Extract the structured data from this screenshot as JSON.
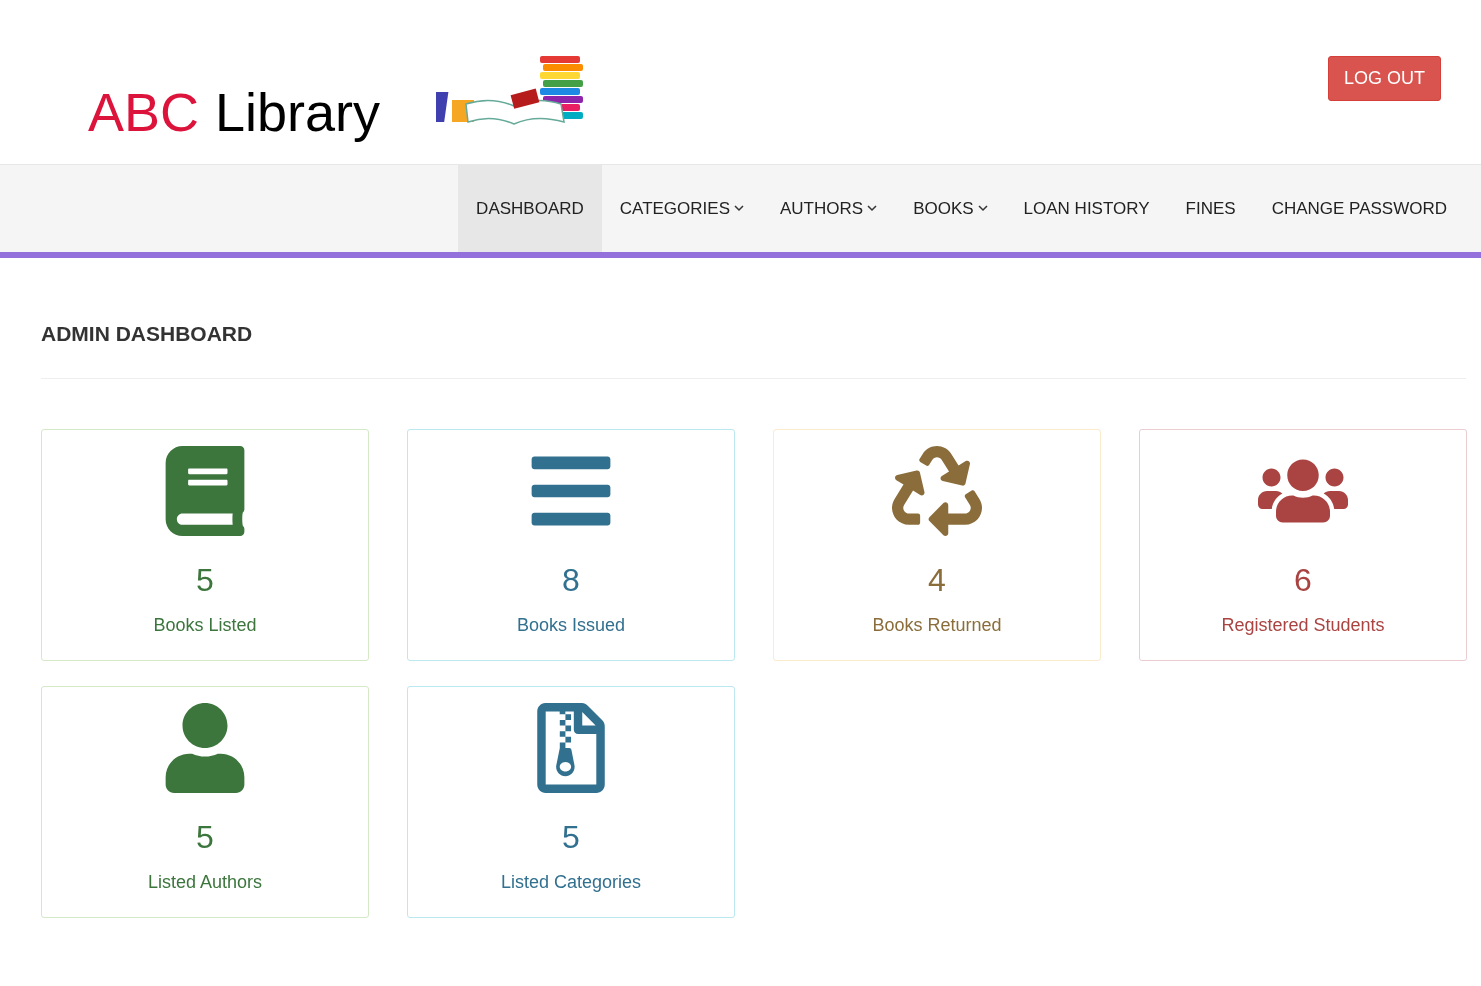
{
  "header": {
    "logo_accent": "ABC",
    "logo_text": "Library",
    "logout": "LOG OUT"
  },
  "nav": [
    {
      "label": "DASHBOARD",
      "selected": true,
      "dropdown": false
    },
    {
      "label": "CATEGORIES",
      "selected": false,
      "dropdown": true
    },
    {
      "label": "AUTHORS",
      "selected": false,
      "dropdown": true
    },
    {
      "label": "BOOKS",
      "selected": false,
      "dropdown": true
    },
    {
      "label": "LOAN HISTORY",
      "selected": false,
      "dropdown": false
    },
    {
      "label": "FINES",
      "selected": false,
      "dropdown": false
    },
    {
      "label": "CHANGE PASSWORD",
      "selected": false,
      "dropdown": false
    }
  ],
  "page_title": "ADMIN DASHBOARD",
  "cards": [
    {
      "kind": "success",
      "count": "5",
      "label": "Books Listed"
    },
    {
      "kind": "info",
      "count": "8",
      "label": "Books Issued"
    },
    {
      "kind": "warning",
      "count": "4",
      "label": "Books Returned"
    },
    {
      "kind": "danger",
      "count": "6",
      "label": "Registered Students"
    },
    {
      "kind": "success",
      "count": "5",
      "label": "Listed Authors"
    },
    {
      "kind": "info",
      "count": "5",
      "label": "Listed Categories"
    }
  ]
}
